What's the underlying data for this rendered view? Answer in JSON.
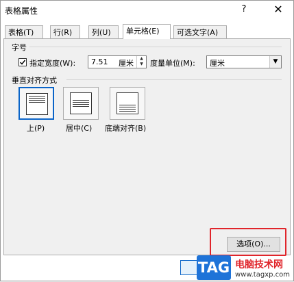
{
  "window": {
    "title": "表格属性",
    "help_glyph": "?",
    "close_glyph": "✕"
  },
  "tabs": [
    {
      "label": "表格(T)"
    },
    {
      "label": "行(R)"
    },
    {
      "label": "列(U)"
    },
    {
      "label": "单元格(E)",
      "active": true
    },
    {
      "label": "可选文字(A)"
    }
  ],
  "size_section": {
    "heading": "字号",
    "width_checkbox_label": "指定宽度(W):",
    "width_checked": true,
    "width_value": "7.51",
    "width_unit": "厘米",
    "measure_label": "度量单位(M):",
    "measure_value": "厘米"
  },
  "valign_section": {
    "heading": "垂直对齐方式",
    "options": [
      {
        "label": "上(P)",
        "selected": true
      },
      {
        "label": "居中(C)"
      },
      {
        "label": "底端对齐(B)"
      }
    ]
  },
  "buttons": {
    "options_label": "选项(O)..."
  },
  "colors": {
    "highlight": "#e0252b",
    "accent": "#0a64c8",
    "watermark_tag": "#1e73d8"
  },
  "watermark": {
    "tag": "TAG",
    "title": "电脑技术网",
    "url": "www.tagxp.com"
  }
}
